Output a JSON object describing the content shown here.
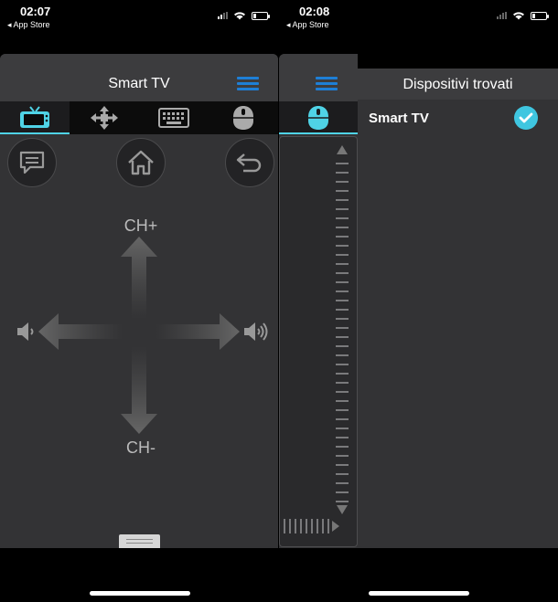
{
  "status_left": {
    "time": "02:07",
    "back": "◂ App Store"
  },
  "status_right": {
    "time": "02:08",
    "back": "◂ App Store"
  },
  "remote": {
    "title": "Smart TV",
    "tabs": [
      "tv-icon",
      "move-icon",
      "keyboard-icon",
      "mouse-icon"
    ],
    "active_tab": 0,
    "ch_up": "CH+",
    "ch_down": "CH-"
  },
  "mouse_panel": {
    "tabs": [
      "mouse-icon"
    ],
    "active_tab": 0
  },
  "devices": {
    "title": "Dispositivi trovati",
    "items": [
      {
        "name": "Smart TV",
        "selected": true
      }
    ]
  },
  "colors": {
    "accent": "#4fd3e6",
    "menu_blue": "#1e7fd6",
    "panel_bg": "#333335"
  }
}
